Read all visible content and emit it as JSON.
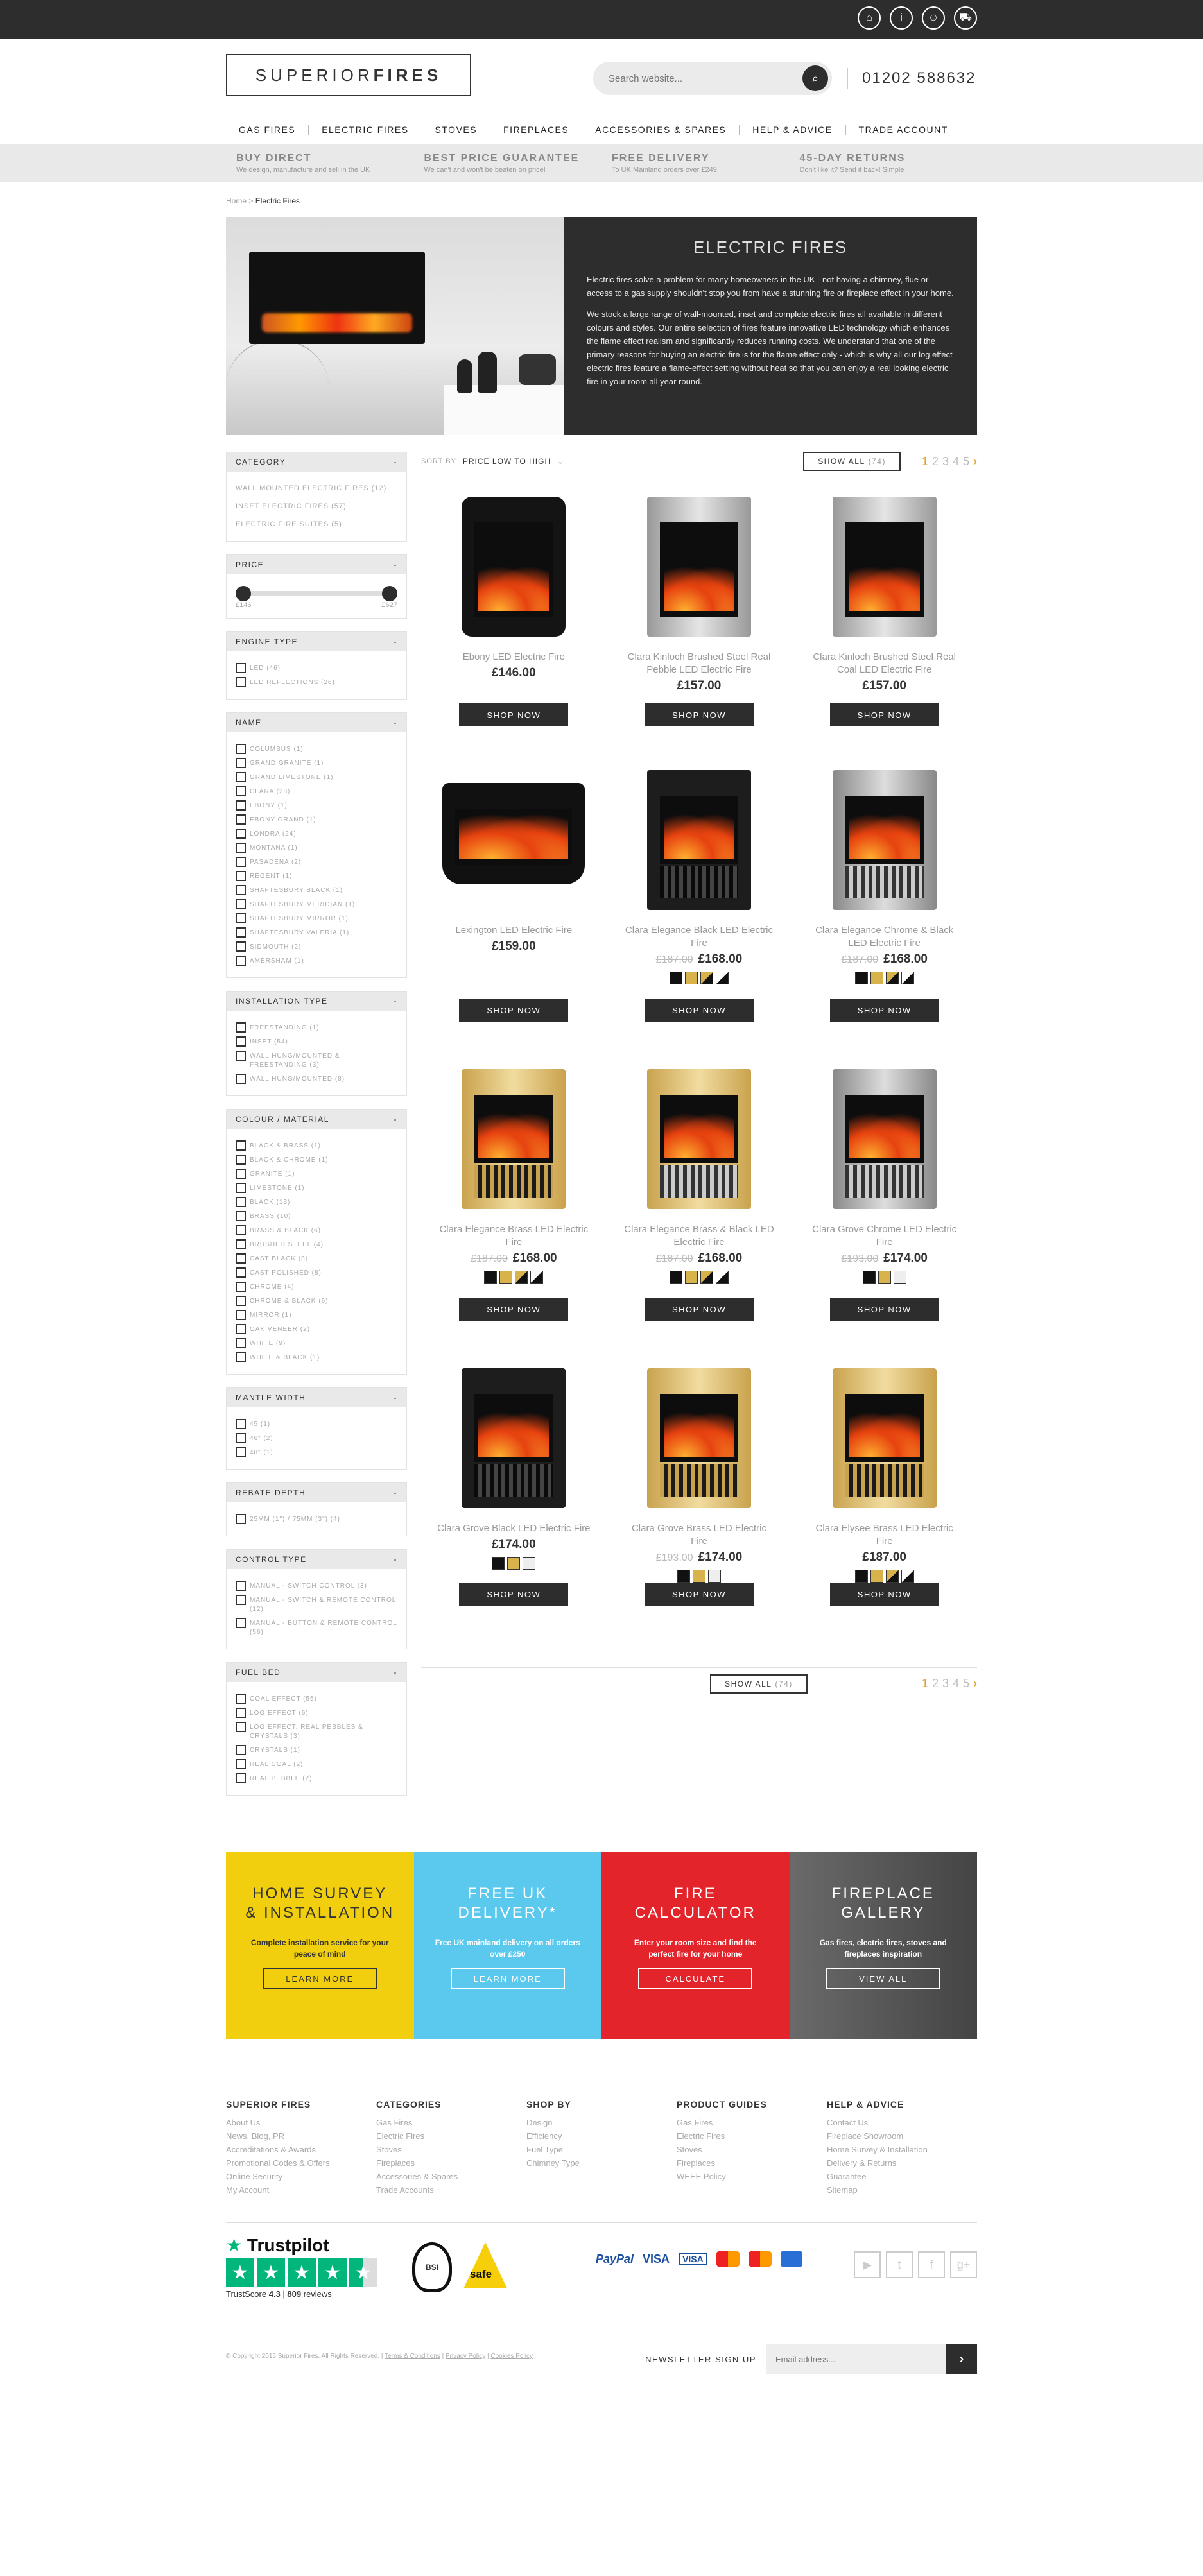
{
  "header": {
    "logo_light": "SUPERIOR",
    "logo_bold": "FIRES",
    "search_placeholder": "Search website...",
    "phone": "01202 588632",
    "icons": [
      "store-icon",
      "info-icon",
      "user-icon",
      "cart-icon"
    ]
  },
  "nav": [
    "GAS FIRES",
    "ELECTRIC FIRES",
    "STOVES",
    "FIREPLACES",
    "ACCESSORIES & SPARES",
    "HELP & ADVICE",
    "TRADE ACCOUNT"
  ],
  "usp": [
    {
      "title": "BUY DIRECT",
      "sub": "We design, manufacture and sell in the UK"
    },
    {
      "title": "BEST PRICE GUARANTEE",
      "sub": "We can't and won't be beaten on price!"
    },
    {
      "title": "FREE DELIVERY",
      "sub": "To UK Mainland orders over £249"
    },
    {
      "title": "45-DAY RETURNS",
      "sub": "Don't like it? Send it back! Simple"
    }
  ],
  "breadcrumb": {
    "home": "Home",
    "sep": ">",
    "current": "Electric Fires"
  },
  "hero": {
    "title": "ELECTRIC FIRES",
    "p1": "Electric fires solve a problem for many homeowners in the UK - not having a chimney, flue or access to a gas supply shouldn't stop you from have a stunning fire or fireplace effect in your home.",
    "p2": "We stock a large range of wall-mounted, inset and complete electric fires all available in different colours and styles. Our entire selection of fires feature innovative LED technology which enhances the flame effect realism and significantly reduces running costs. We understand that one of the primary reasons for buying an electric fire is for the flame effect only - which is why all our log effect electric fires feature a flame-effect setting without heat so that you can enjoy a real looking electric fire in your room all year round."
  },
  "filters": {
    "category": {
      "title": "CATEGORY",
      "items": [
        "WALL MOUNTED ELECTRIC FIRES (12)",
        "INSET ELECTRIC FIRES (57)",
        "ELECTRIC FIRE SUITES (5)"
      ]
    },
    "price": {
      "title": "PRICE",
      "min": "£146",
      "max": "£627"
    },
    "engine": {
      "title": "ENGINE TYPE",
      "items": [
        "LED (46)",
        "LED REFLECTIONS (26)"
      ]
    },
    "name": {
      "title": "NAME",
      "items": [
        "COLUMBUS (1)",
        "GRAND GRANITE (1)",
        "GRAND LIMESTONE (1)",
        "CLARA (28)",
        "EBONY (1)",
        "EBONY GRAND (1)",
        "LONDRA (24)",
        "MONTANA (1)",
        "PASADENA (2)",
        "REGENT (1)",
        "SHAFTESBURY BLACK (1)",
        "SHAFTESBURY MERIDIAN (1)",
        "SHAFTESBURY MIRROR (1)",
        "SHAFTESBURY VALERIA (1)",
        "SIDMOUTH (2)",
        "AMERSHAM (1)"
      ]
    },
    "install": {
      "title": "INSTALLATION TYPE",
      "items": [
        "FREESTANDING (1)",
        "INSET (54)",
        "WALL HUNG/MOUNTED & FREESTANDING (3)",
        "WALL HUNG/MOUNTED (8)"
      ]
    },
    "colour": {
      "title": "COLOUR / MATERIAL",
      "items": [
        "BLACK & BRASS (1)",
        "BLACK & CHROME (1)",
        "GRANITE (1)",
        "LIMESTONE (1)",
        "BLACK (13)",
        "BRASS (10)",
        "BRASS & BLACK (6)",
        "BRUSHED STEEL (4)",
        "CAST BLACK (8)",
        "CAST POLISHED (8)",
        "CHROME (4)",
        "CHROME & BLACK (6)",
        "MIRROR (1)",
        "OAK VENEER (2)",
        "WHITE (9)",
        "WHITE & BLACK (1)"
      ]
    },
    "mantle": {
      "title": "MANTLE WIDTH",
      "items": [
        "45 (1)",
        "46\" (2)",
        "48\" (1)"
      ]
    },
    "rebate": {
      "title": "REBATE DEPTH",
      "items": [
        "25MM (1\") / 75MM (3\") (4)"
      ]
    },
    "control": {
      "title": "CONTROL TYPE",
      "items": [
        "MANUAL - SWITCH CONTROL (3)",
        "MANUAL - SWITCH & REMOTE CONTROL (12)",
        "MANUAL - BUTTON & REMOTE CONTROL (56)"
      ]
    },
    "fuel": {
      "title": "FUEL BED",
      "items": [
        "COAL EFFECT (55)",
        "LOG EFFECT (6)",
        "LOG EFFECT, REAL PEBBLES & CRYSTALS (3)",
        "CRYSTALS (1)",
        "REAL COAL (2)",
        "REAL PEBBLE (2)"
      ]
    }
  },
  "toolbar": {
    "sort_label": "SORT BY",
    "sort_value": "PRICE LOW TO HIGH",
    "show_all": "SHOW ALL",
    "show_count": "(74)",
    "pages": [
      "1",
      "2",
      "3",
      "4",
      "5"
    ],
    "next": "›"
  },
  "products": [
    {
      "name": "Ebony LED Electric Fire",
      "old": "",
      "price": "£146.00",
      "style": "black"
    },
    {
      "name": "Clara Kinloch Brushed Steel Real Pebble LED Electric Fire",
      "old": "",
      "price": "£157.00",
      "style": "steel"
    },
    {
      "name": "Clara Kinloch Brushed Steel Real Coal LED Electric Fire",
      "old": "",
      "price": "£157.00",
      "style": "steel"
    },
    {
      "name": "Lexington LED Electric Fire",
      "old": "",
      "price": "£159.00",
      "style": "wide"
    },
    {
      "name": "Clara Elegance Black LED Electric Fire",
      "old": "£187.00",
      "price": "£168.00",
      "style": "blackgrate"
    },
    {
      "name": "Clara Elegance Chrome & Black LED Electric Fire",
      "old": "£187.00",
      "price": "£168.00",
      "style": "chrome"
    },
    {
      "name": "Clara Elegance Brass LED Electric Fire",
      "old": "£187.00",
      "price": "£168.00",
      "style": "brass"
    },
    {
      "name": "Clara Elegance Brass & Black LED Electric Fire",
      "old": "£187.00",
      "price": "£168.00",
      "style": "brassblack"
    },
    {
      "name": "Clara Grove Chrome LED Electric Fire",
      "old": "£193.00",
      "price": "£174.00",
      "style": "chrome"
    },
    {
      "name": "Clara Grove Black LED Electric Fire",
      "old": "",
      "price": "£174.00",
      "style": "blackgrate"
    },
    {
      "name": "Clara Grove Brass LED Electric Fire",
      "old": "£193.00",
      "price": "£174.00",
      "style": "brass"
    },
    {
      "name": "Clara Elysee Brass LED Electric Fire",
      "old": "",
      "price": "£187.00",
      "style": "brass"
    }
  ],
  "shop_now": "SHOP NOW",
  "banners": [
    {
      "title": "HOME SURVEY & INSTALLATION",
      "text": "Complete installation service for your peace of mind",
      "btn": "LEARN MORE",
      "bg": "#f1cf0f",
      "fg": "#333"
    },
    {
      "title": "FREE UK DELIVERY*",
      "text": "Free UK mainland delivery on all orders over £250",
      "btn": "LEARN MORE",
      "bg": "#5bc9ee",
      "fg": "#fff"
    },
    {
      "title": "FIRE CALCULATOR",
      "text": "Enter your room size and find the perfect fire for your home",
      "btn": "CALCULATE",
      "bg": "#e3242b",
      "fg": "#fff"
    },
    {
      "title": "FIREPLACE GALLERY",
      "text": "Gas fires, electric fires, stoves and fireplaces inspiration",
      "btn": "VIEW ALL",
      "bg": "#555555",
      "fg": "#fff"
    }
  ],
  "footer": [
    {
      "title": "SUPERIOR FIRES",
      "links": [
        "About Us",
        "News, Blog, PR",
        "Accreditations & Awards",
        "Promotional Codes & Offers",
        "Online Security",
        "My Account"
      ]
    },
    {
      "title": "CATEGORIES",
      "links": [
        "Gas Fires",
        "Electric Fires",
        "Stoves",
        "Fireplaces",
        "Accessories & Spares",
        "Trade Accounts"
      ]
    },
    {
      "title": "SHOP BY",
      "links": [
        "Design",
        "Efficiency",
        "Fuel Type",
        "Chimney Type"
      ]
    },
    {
      "title": "PRODUCT GUIDES",
      "links": [
        "Gas Fires",
        "Electric Fires",
        "Stoves",
        "Fireplaces",
        "WEEE Policy"
      ]
    },
    {
      "title": "HELP & ADVICE",
      "links": [
        "Contact Us",
        "Fireplace Showroom",
        "Home Survey & Installation",
        "Delivery & Returns",
        "Guarantee",
        "Sitemap"
      ]
    }
  ],
  "trust": {
    "brand": "Trustpilot",
    "score_label": "TrustScore",
    "score": "4.3",
    "reviews": "809",
    "reviews_label": "reviews",
    "bsi": "BSI",
    "gassafe": "safe",
    "paypal": "PayPal",
    "visa": "VISA"
  },
  "copyright": "© Copyright 2015 Superior Fires. All Rights Reserved.",
  "legal": [
    "Terms & Conditions",
    "Privacy Policy",
    "Cookies Policy"
  ],
  "newsletter": {
    "label": "NEWSLETTER SIGN UP",
    "placeholder": "Email address...",
    "btn": "›"
  }
}
